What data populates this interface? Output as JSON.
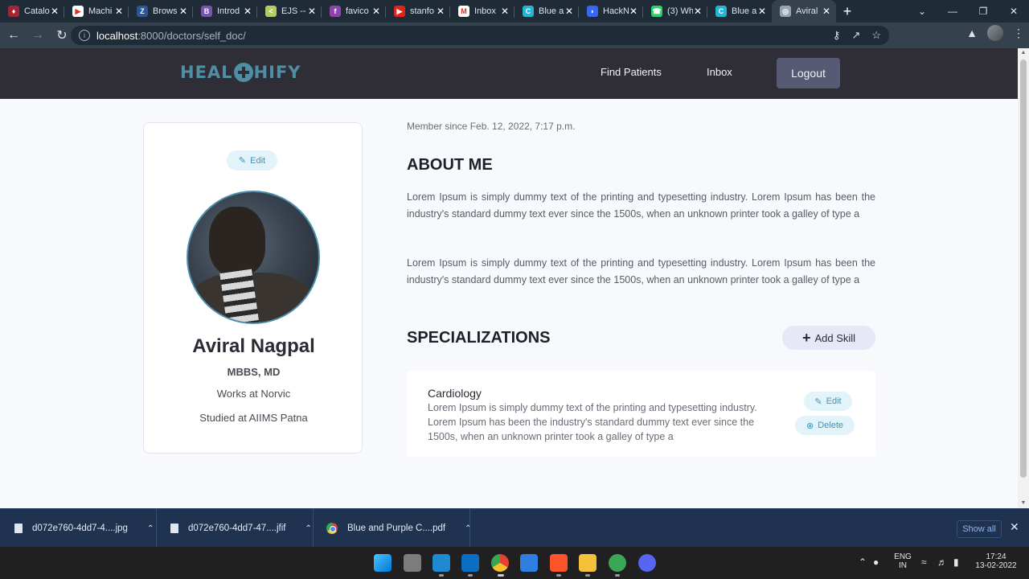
{
  "browser": {
    "tabs": [
      {
        "title": "Catalo",
        "fav_color": "#a32638",
        "fav_char": "♦"
      },
      {
        "title": "Machi",
        "fav_color": "#ffffff",
        "fav_char": "▶"
      },
      {
        "title": "Brows",
        "fav_color": "#2b5797",
        "fav_char": "Z"
      },
      {
        "title": "Introd",
        "fav_color": "#7952b3",
        "fav_char": "B"
      },
      {
        "title": "EJS --",
        "fav_color": "#b4ca65",
        "fav_char": "<"
      },
      {
        "title": "favico",
        "fav_color": "#8e44ad",
        "fav_char": "f"
      },
      {
        "title": "stanfo",
        "fav_color": "#e62117",
        "fav_char": "▶"
      },
      {
        "title": "Inbox",
        "fav_color": "#ffffff",
        "fav_char": "M"
      },
      {
        "title": "Blue a",
        "fav_color": "#23b5d3",
        "fav_char": "C"
      },
      {
        "title": "HackN",
        "fav_color": "#3767f5",
        "fav_char": "◗"
      },
      {
        "title": "(3) Wh",
        "fav_color": "#25d366",
        "fav_char": "☎"
      },
      {
        "title": "Blue a",
        "fav_color": "#23b5d3",
        "fav_char": "C"
      },
      {
        "title": "Aviral",
        "fav_color": "#9aa4ae",
        "fav_char": "◎"
      }
    ],
    "active_tab_index": 12,
    "address": {
      "host": "localhost",
      "path": ":8000/doctors/self_doc/"
    }
  },
  "site": {
    "brand_left": "HEAL",
    "brand_right": "HIFY",
    "nav": {
      "find_patients": "Find Patients",
      "inbox": "Inbox",
      "logout": "Logout"
    }
  },
  "profile": {
    "edit_label": "Edit",
    "name": "Aviral Nagpal",
    "degree": "MBBS, MD",
    "works_at": "Works at Norvic",
    "studied_at": "Studied at AIIMS Patna"
  },
  "main": {
    "member_since": "Member since Feb. 12, 2022, 7:17 p.m.",
    "about_title": "ABOUT ME",
    "about_paragraphs": [
      "Lorem Ipsum is simply dummy text of the printing and typesetting industry. Lorem Ipsum has been the industry's standard dummy text ever since the 1500s, when an unknown printer took a galley of type a",
      "Lorem Ipsum is simply dummy text of the printing and typesetting industry. Lorem Ipsum has been the industry's standard dummy text ever since the 1500s, when an unknown printer took a galley of type a"
    ],
    "specializations_title": "SPECIALIZATIONS",
    "add_skill_label": "Add Skill",
    "specializations": [
      {
        "title": "Cardiology",
        "description": "Lorem Ipsum is simply dummy text of the printing and typesetting industry. Lorem Ipsum has been the industry's standard dummy text ever since the 1500s, when an unknown printer took a galley of type a",
        "edit_label": "Edit",
        "delete_label": "Delete"
      }
    ]
  },
  "downloads": {
    "items": [
      "d072e760-4dd7-4....jpg",
      "d072e760-4dd7-47....jfif",
      "Blue and Purple C....pdf"
    ],
    "show_all": "Show all"
  },
  "taskbar": {
    "lang_top": "ENG",
    "lang_bottom": "IN",
    "time": "17:24",
    "date": "13-02-2022"
  },
  "colors": {
    "brand": "#4f8fa6",
    "nav_bg": "#2f2e36",
    "logout_bg": "#575a73",
    "accent_pill": "#e3f3fa",
    "add_skill_bg": "#e6e8f7"
  }
}
